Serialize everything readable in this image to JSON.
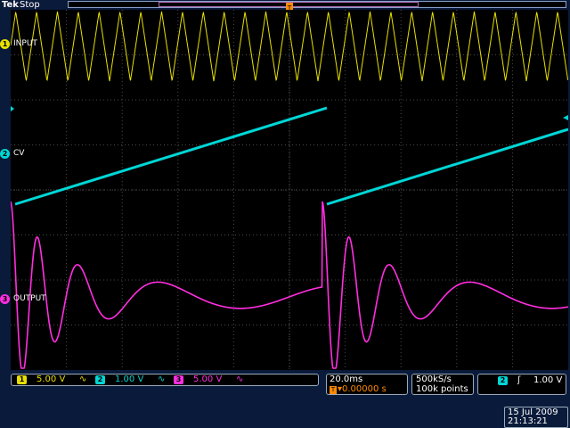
{
  "header": {
    "brand": "Tek",
    "run_state": "Stop"
  },
  "channels": [
    {
      "id": "1",
      "label": "INPUT",
      "color": "#e8e000"
    },
    {
      "id": "2",
      "label": "CV",
      "color": "#00d6d6"
    },
    {
      "id": "3",
      "label": "OUTPUT",
      "color": "#ff2ee0"
    }
  ],
  "status": {
    "ch1_scale": "5.00 V",
    "ch2_scale": "1.00 V",
    "ch3_scale": "5.00 V",
    "coupling_glyph": "∿",
    "timebase": "20.0ms",
    "trigger_offset": "▾0.00000 s",
    "sample_rate": "500kS/s",
    "record_length": "100k points",
    "trigger_channel": "2",
    "trigger_slope": "ʃ",
    "trigger_level": "1.00 V",
    "date": "15 Jul 2009",
    "time": "21:13:21"
  },
  "colors": {
    "ch1": "#e8e000",
    "ch2": "#00d6d6",
    "ch3": "#ff2ee0",
    "grid": "#4a4a4a",
    "background": "#000000",
    "frame": "#0a1a3a"
  },
  "icons": {
    "trigger_position": "trigger-position-marker-icon",
    "trigger_level": "trigger-level-arrow-icon"
  }
}
